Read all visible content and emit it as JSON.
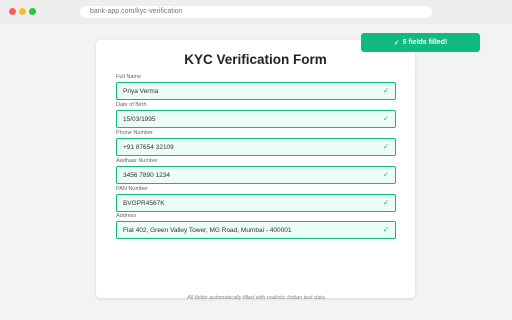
{
  "browser": {
    "url": "bank-app.com/kyc-verification"
  },
  "toast": {
    "icon": "✓",
    "text": "5 fields filled!"
  },
  "form": {
    "title": "KYC Verification Form",
    "check_icon": "✓",
    "fields": [
      {
        "label": "Full Name",
        "value": "Priya Verma"
      },
      {
        "label": "Date of Birth",
        "value": "15/03/1995"
      },
      {
        "label": "Phone Number",
        "value": "+91 87654 32109"
      },
      {
        "label": "Aadhaar Number",
        "value": "3456 7890 1234"
      },
      {
        "label": "PAN Number",
        "value": "BVGPR4567K"
      },
      {
        "label": "Address",
        "value": "Flat 402, Green Valley Tower, MG Road, Mumbai - 400001"
      }
    ]
  },
  "footnote": "All fields automatically filled with realistic Indian test data",
  "colors": {
    "accent": "#10b981",
    "field_bg": "#ecfdf5"
  }
}
